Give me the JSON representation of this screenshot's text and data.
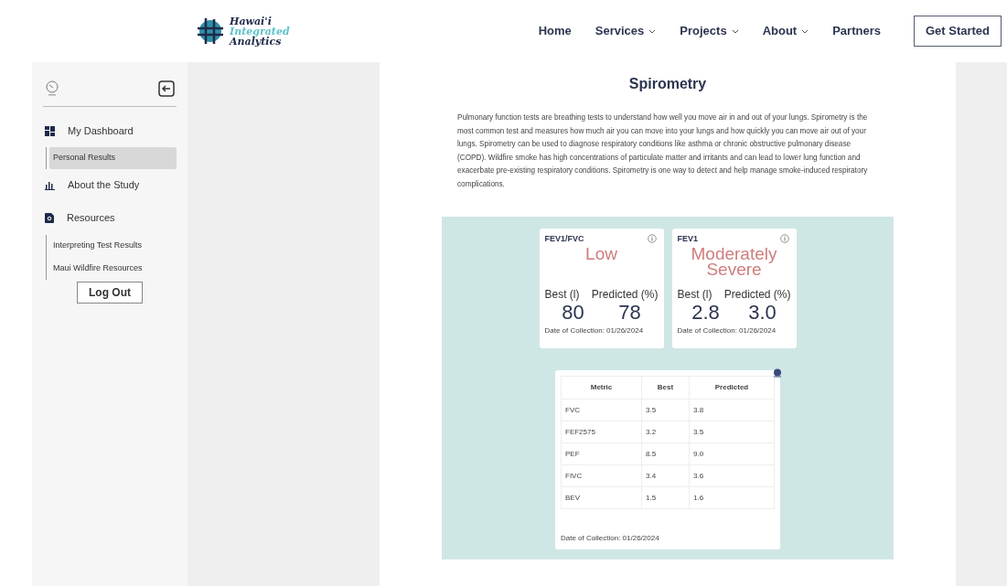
{
  "header": {
    "logo": [
      "Hawai'i",
      "Integrated",
      "Analytics"
    ],
    "nav": [
      {
        "label": "Home",
        "dropdown": false
      },
      {
        "label": "Services",
        "dropdown": true
      },
      {
        "label": "Projects",
        "dropdown": true
      },
      {
        "label": "About",
        "dropdown": true
      },
      {
        "label": "Partners",
        "dropdown": false
      }
    ],
    "cta": "Get Started"
  },
  "sidebar": {
    "items": [
      {
        "label": "My Dashboard",
        "kind": "dashboard",
        "children": [
          {
            "label": "Personal Results",
            "selected": true
          }
        ]
      },
      {
        "label": "About the Study",
        "kind": "chart"
      },
      {
        "label": "Resources",
        "kind": "document",
        "children": [
          {
            "label": "Interpreting Test Results",
            "selected": false
          },
          {
            "label": "Maui Wildfire Resources",
            "selected": false
          }
        ]
      }
    ],
    "logout": "Log Out"
  },
  "main": {
    "title": "Spirometry",
    "intro": "Pulmonary function tests are breathing tests to understand how well you move air in and out of your lungs. Spirometry is the most common test and measures how much air you can move into your lungs and how quickly you can move air out of your lungs. Spirometry can be used to diagnose  respiratory conditions like asthma or chronic obstructive pulmonary disease (COPD). Wildfire smoke has high concentrations of particulate matter and irritants and can lead to lower lung function and exacerbate pre-existing respiratory conditions. Spirometry is one way to detect and help manage smoke-induced respiratory complications.",
    "cards": [
      {
        "title": "FEV1/FVC",
        "status": "Low",
        "labels": [
          "Best (l)",
          "Predicted (%)"
        ],
        "values": [
          "80",
          "78"
        ],
        "date": "Date of Collection: 01/26/2024"
      },
      {
        "title": "FEV1",
        "status": "Moderately Severe",
        "labels": [
          "Best (l)",
          "Predicted (%)"
        ],
        "values": [
          "2.8",
          "3.0"
        ],
        "date": "Date of Collection: 01/26/2024"
      }
    ],
    "table": {
      "columns": [
        "Metric",
        "Best",
        "Predicted"
      ],
      "rows": [
        [
          "FVC",
          "3.5",
          "3.8"
        ],
        [
          "FEF2575",
          "3.2",
          "3.5"
        ],
        [
          "PEF",
          "8.5",
          "9.0"
        ],
        [
          "FIVC",
          "3.4",
          "3.6"
        ],
        [
          "BEV",
          "1.5",
          "1.6"
        ]
      ],
      "date": "Date of Collection: 01/26/2024"
    }
  }
}
